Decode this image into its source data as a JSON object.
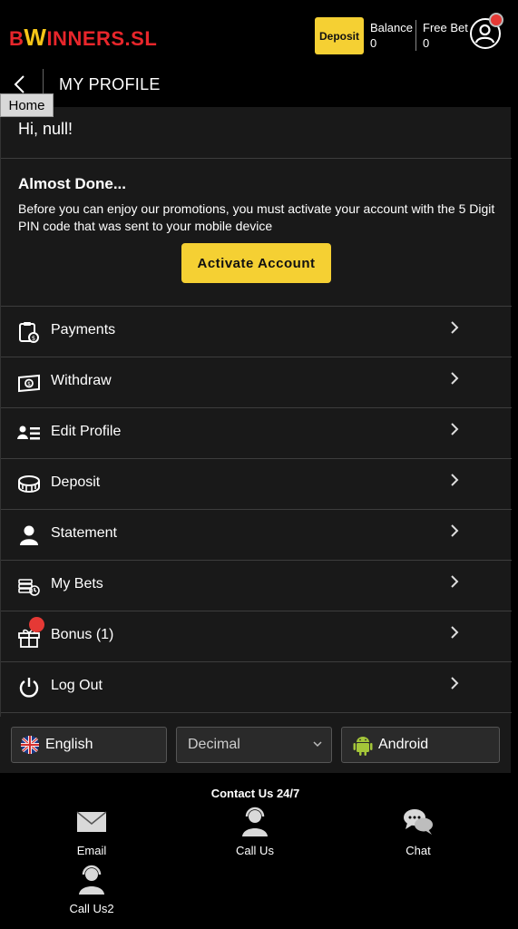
{
  "brand": {
    "logo_prefix": "B",
    "logo_w": "W",
    "logo_rest": "INNERS.SL"
  },
  "account_bar": {
    "deposit_label": "Deposit",
    "balance_label": "Balance",
    "balance_value": "0",
    "freebet_label": "Free Bet",
    "freebet_value": "0"
  },
  "header": {
    "title": "MY PROFILE",
    "back_icon": "chevron-left-icon",
    "tooltip": "Home"
  },
  "greeting": "Hi, null!",
  "activation": {
    "heading": "Almost Done...",
    "message": "Before you can enjoy our promotions, you must activate your account with the 5 Digit PIN code that was sent to your mobile device",
    "button_label": "Activate Account"
  },
  "menu": [
    {
      "label": "Payments",
      "icon": "payments-icon"
    },
    {
      "label": "Withdraw",
      "icon": "withdraw-icon"
    },
    {
      "label": "Edit Profile",
      "icon": "edit-profile-icon"
    },
    {
      "label": "Deposit",
      "icon": "deposit-icon"
    },
    {
      "label": "Statement",
      "icon": "user-icon"
    },
    {
      "label": "My Bets",
      "icon": "bets-icon"
    },
    {
      "label": "Bonus (1)",
      "icon": "gift-icon"
    },
    {
      "label": "Log Out",
      "icon": "power-icon"
    }
  ],
  "settings": {
    "language": "English",
    "odds_format": "Decimal",
    "app": "Android"
  },
  "footer": {
    "contact_heading": "Contact Us 24/7",
    "items": [
      {
        "label": "Email",
        "icon": "envelope-icon"
      },
      {
        "label": "Call Us",
        "icon": "headset-icon"
      },
      {
        "label": "Chat",
        "icon": "chat-icon"
      },
      {
        "label": "Call Us2",
        "icon": "headset-icon"
      }
    ]
  },
  "colors": {
    "accent_yellow": "#f5d033",
    "logo_red": "#e8262b",
    "notification_red": "#e53935",
    "panel_bg": "#191919"
  }
}
